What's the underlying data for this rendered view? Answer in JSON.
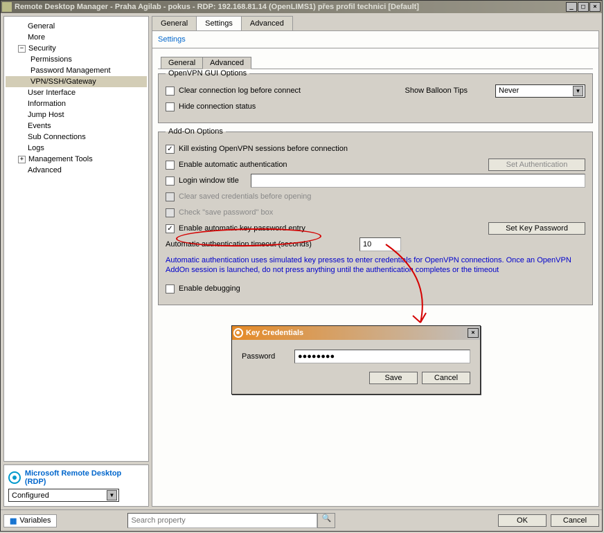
{
  "window": {
    "title": "Remote Desktop Manager - Praha Agilab - pokus - RDP: 192.168.81.14 (OpenLIMS1) přes profil technici [Default]",
    "minimize": "_",
    "maximize": "□",
    "close": "×"
  },
  "tree": {
    "items": [
      {
        "label": "General",
        "indent": 1
      },
      {
        "label": "More",
        "indent": 1
      },
      {
        "label": "Security",
        "indent": 1,
        "expand": "−"
      },
      {
        "label": "Permissions",
        "indent": 2
      },
      {
        "label": "Password Management",
        "indent": 2
      },
      {
        "label": "VPN/SSH/Gateway",
        "indent": 2,
        "selected": true
      },
      {
        "label": "User Interface",
        "indent": 1
      },
      {
        "label": "Information",
        "indent": 1
      },
      {
        "label": "Jump Host",
        "indent": 1
      },
      {
        "label": "Events",
        "indent": 1
      },
      {
        "label": "Sub Connections",
        "indent": 1
      },
      {
        "label": "Logs",
        "indent": 1
      },
      {
        "label": "Management Tools",
        "indent": 1,
        "expand": "+"
      },
      {
        "label": "Advanced",
        "indent": 1
      }
    ]
  },
  "rdp": {
    "title": "Microsoft Remote Desktop (RDP)",
    "combo": "Configured"
  },
  "outer_tabs": [
    "General",
    "Settings",
    "Advanced"
  ],
  "outer_tab_active": 1,
  "settings_label": "Settings",
  "inner_tabs": [
    "General",
    "Advanced"
  ],
  "inner_tab_active": 1,
  "gui_group": {
    "legend": "OpenVPN GUI Options",
    "clear_log": {
      "checked": false,
      "label": "Clear connection log before connect"
    },
    "balloon_label": "Show Balloon Tips",
    "balloon_value": "Never",
    "hide_status": {
      "checked": false,
      "label": "Hide connection status"
    }
  },
  "addon_group": {
    "legend": "Add-On Options",
    "kill_existing": {
      "checked": true,
      "label": "Kill existing OpenVPN sessions before connection"
    },
    "enable_auth": {
      "checked": false,
      "label": "Enable automatic authentication"
    },
    "set_auth_btn": "Set Authentication",
    "login_title": {
      "checked": false,
      "label": "Login window title",
      "value": ""
    },
    "clear_saved": {
      "checked": false,
      "label": "Clear saved credentials before opening",
      "disabled": true
    },
    "check_save": {
      "checked": false,
      "label": "Check \"save password\" box",
      "disabled": true
    },
    "enable_key": {
      "checked": true,
      "label": "Enable automatic key password entry"
    },
    "set_key_btn": "Set Key Password",
    "timeout_label": "Automatic authentication timeout (seconds)",
    "timeout_value": "10",
    "info": "Automatic authentication uses simulated key presses to enter credentials for OpenVPN connections.  Once an OpenVPN AddOn session is launched, do not press anything until the authentication completes or the timeout",
    "enable_debug": {
      "checked": false,
      "label": "Enable debugging"
    }
  },
  "dialog": {
    "title": "Key Credentials",
    "password_label": "Password",
    "password_value": "●●●●●●●●",
    "save": "Save",
    "cancel": "Cancel",
    "close": "×"
  },
  "bottom": {
    "variables": "Variables",
    "search_placeholder": "Search property",
    "ok": "OK",
    "cancel": "Cancel"
  }
}
